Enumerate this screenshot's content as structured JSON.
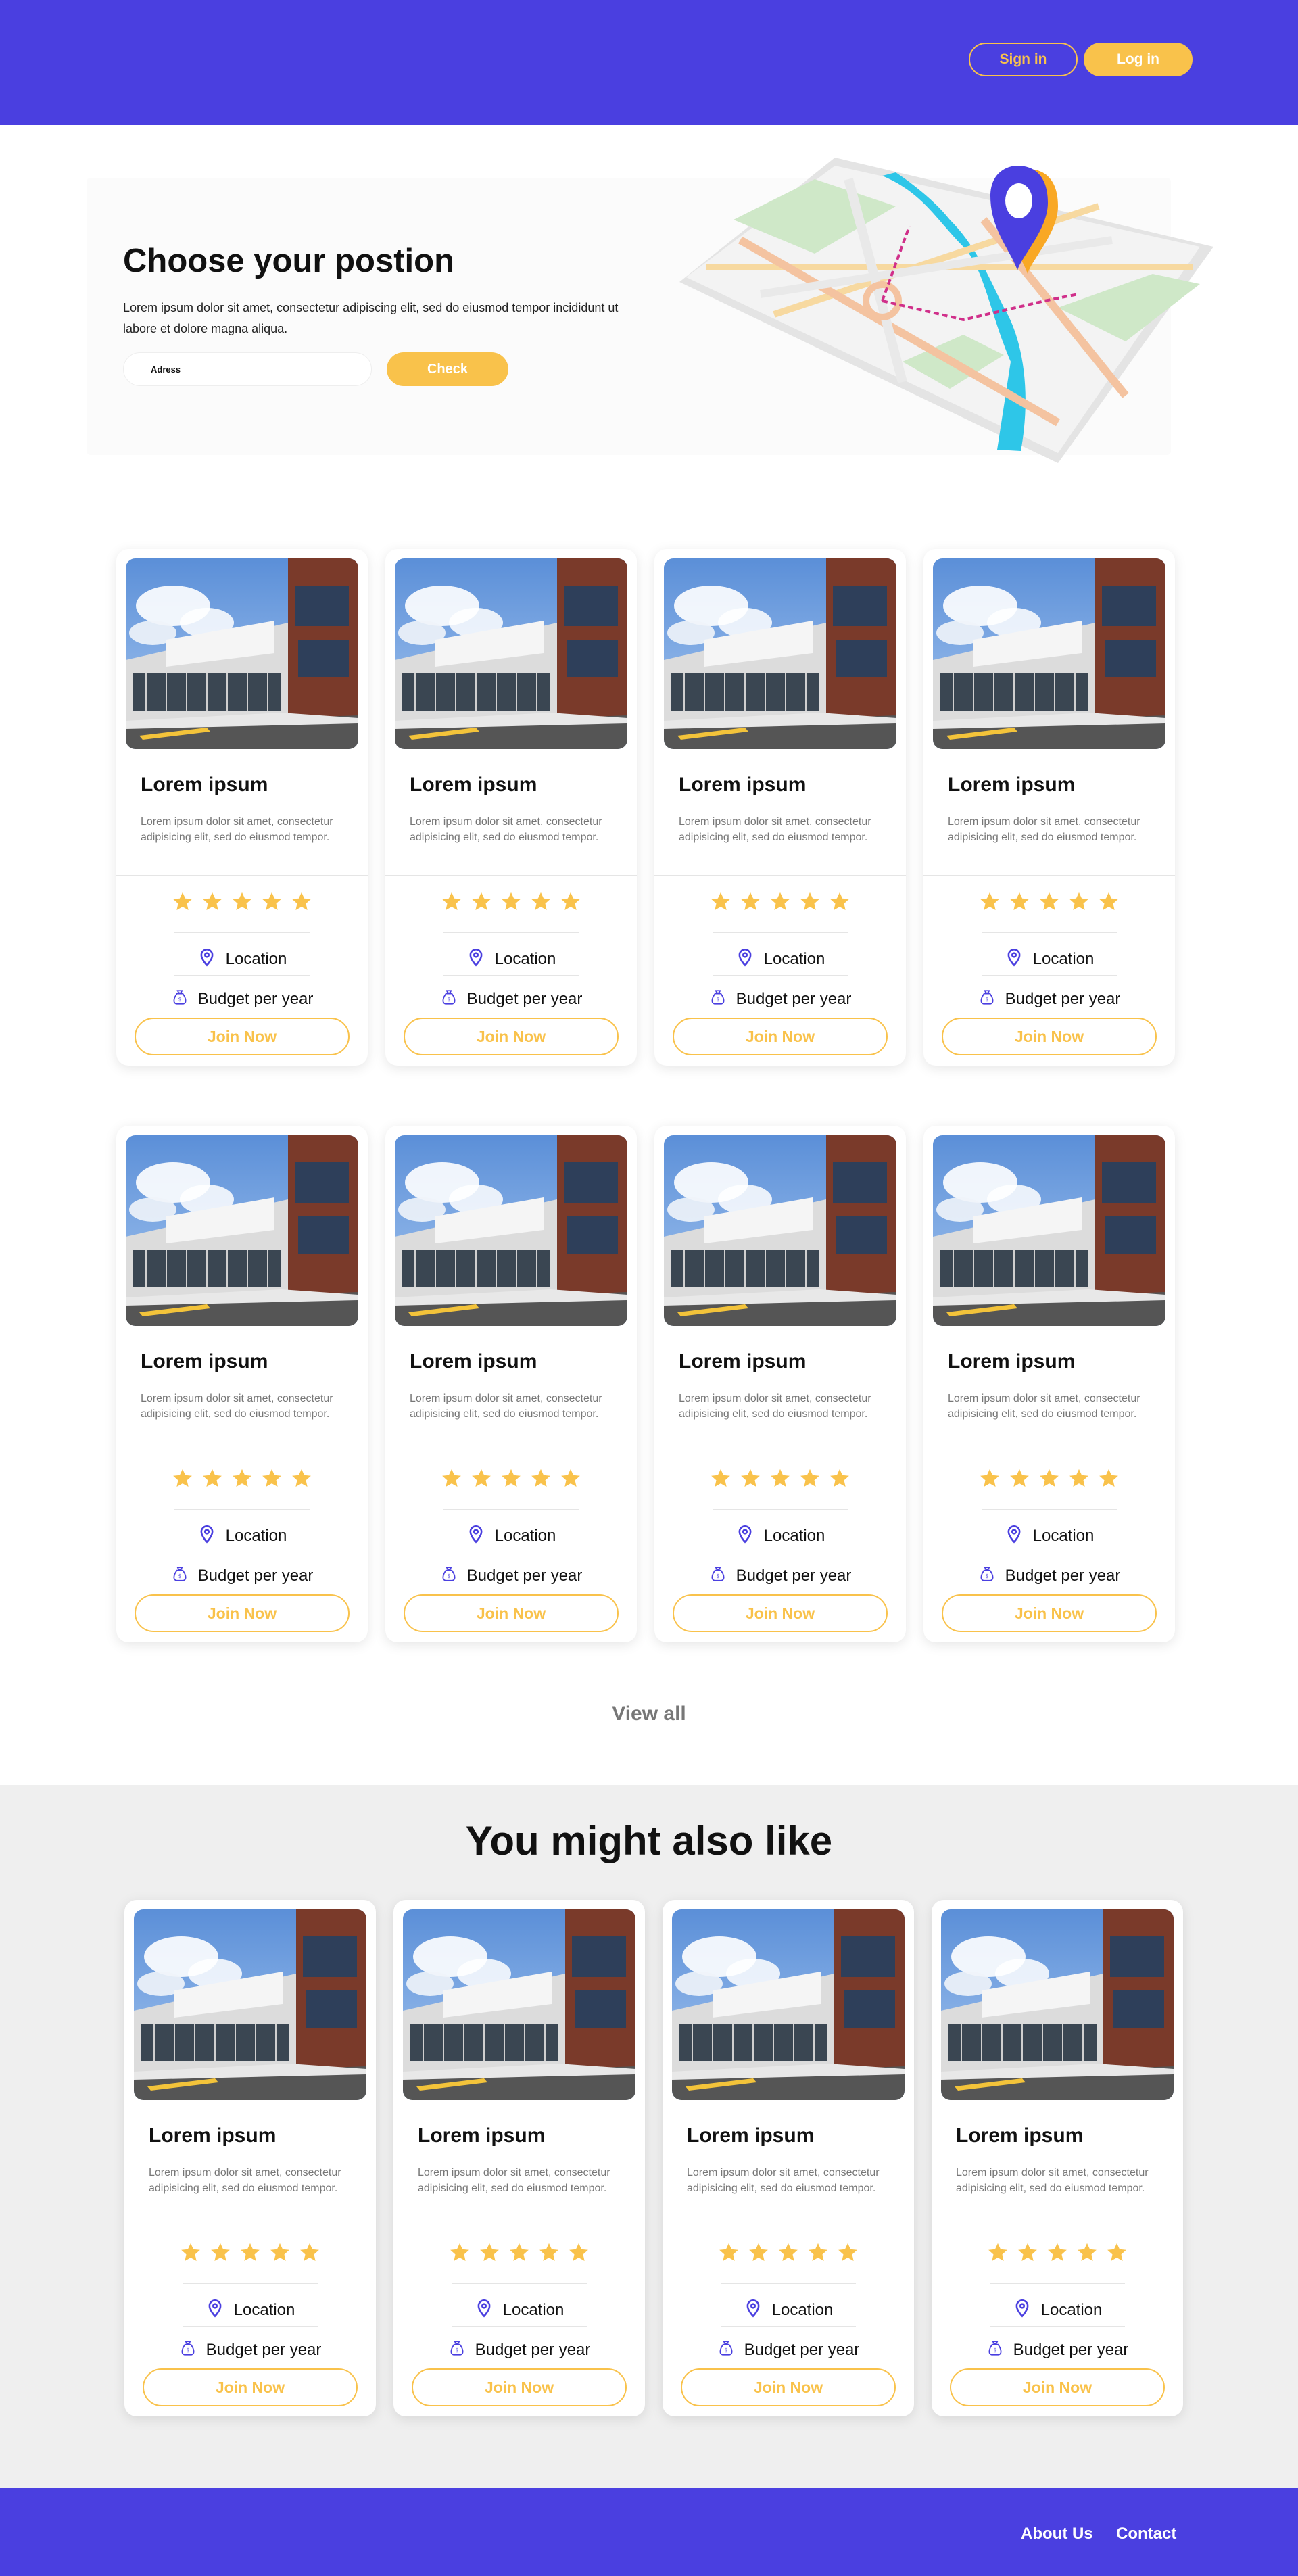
{
  "header": {
    "sign_in_label": "Sign in",
    "log_in_label": "Log in"
  },
  "hero": {
    "title": "Choose your postion",
    "description": "Lorem ipsum dolor sit amet, consectetur adipiscing elit, sed do eiusmod tempor incididunt ut labore et dolore magna aliqua.",
    "address_placeholder": "Adress",
    "check_label": "Check"
  },
  "card_template": {
    "title": "Lorem ipsum",
    "description": "Lorem ipsum dolor sit amet, consectetur adipisicing elit, sed do eiusmod tempor.",
    "rating_stars": 5,
    "location_label": "Location",
    "budget_label": "Budget per year",
    "join_label": "Join Now"
  },
  "view_all_label": "View all",
  "also_like": {
    "title": "You might also like"
  },
  "footer": {
    "about_label": "About Us",
    "contact_label": "Contact"
  },
  "colors": {
    "brand_purple": "#4a3fe0",
    "accent_yellow": "#f9c24b",
    "section_gray": "#efefef"
  },
  "icons": {
    "location": "map-pin-icon",
    "budget": "money-bag-icon",
    "rating": "star-icon"
  }
}
